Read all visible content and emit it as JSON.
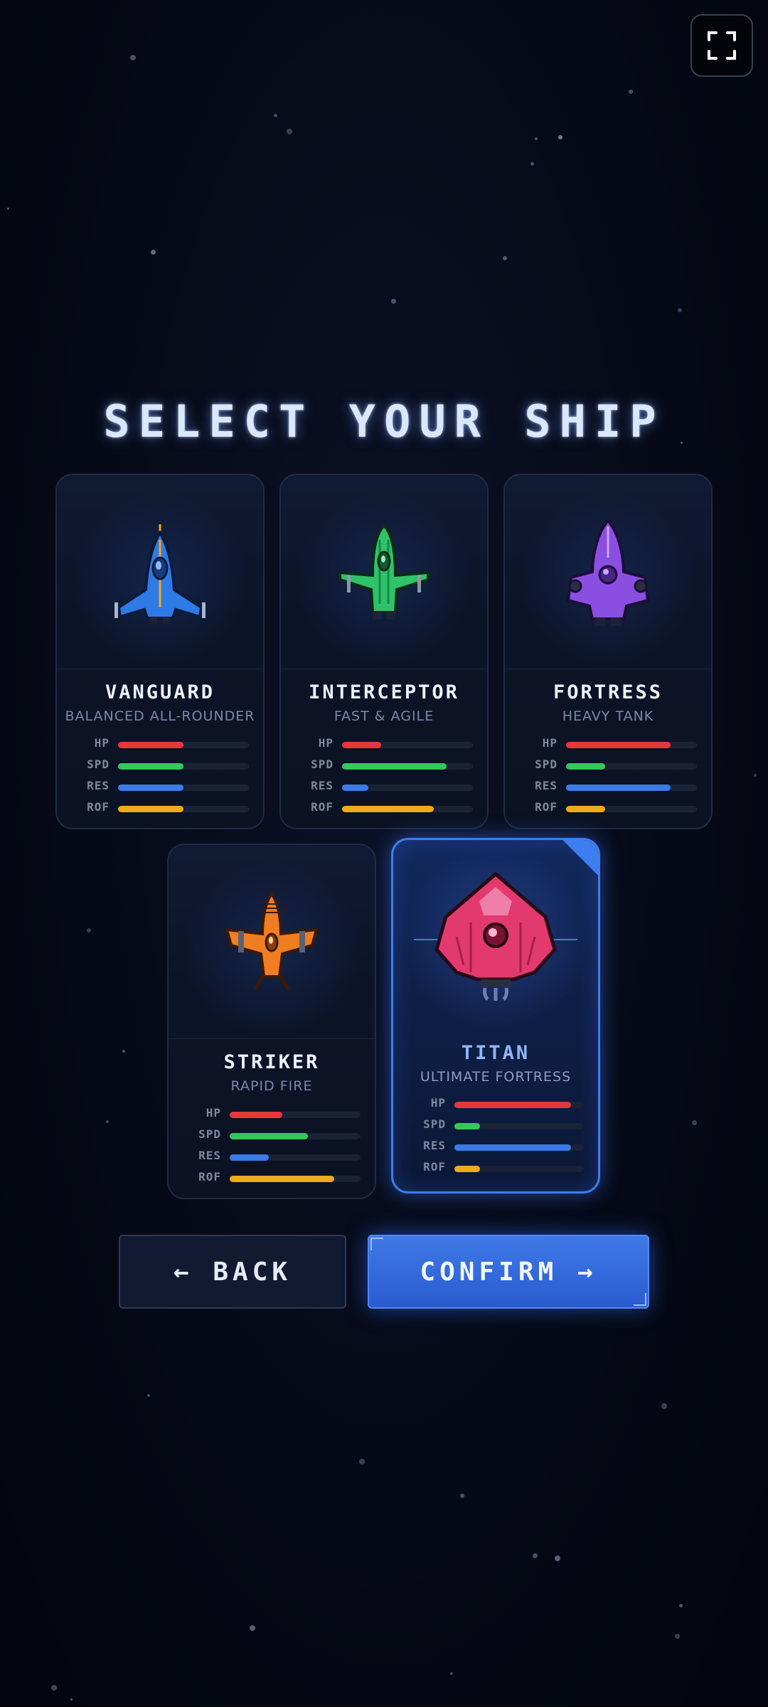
{
  "screen": {
    "title": "SELECT YOUR SHIP",
    "fullscreen_icon": "fullscreen-icon"
  },
  "ships": [
    {
      "name": "VANGUARD",
      "subtitle": "BALANCED ALL-ROUNDER",
      "color": "#2f7be6",
      "selected": false,
      "stats": [
        {
          "label": "HP",
          "value": 0.5,
          "color": "#e5383b"
        },
        {
          "label": "SPD",
          "value": 0.5,
          "color": "#35c759"
        },
        {
          "label": "RES",
          "value": 0.5,
          "color": "#3a7be8"
        },
        {
          "label": "ROF",
          "value": 0.5,
          "color": "#f0a91c"
        }
      ]
    },
    {
      "name": "INTERCEPTOR",
      "subtitle": "FAST & AGILE",
      "color": "#2ec26a",
      "selected": false,
      "stats": [
        {
          "label": "HP",
          "value": 0.3,
          "color": "#e5383b"
        },
        {
          "label": "SPD",
          "value": 0.8,
          "color": "#35c759"
        },
        {
          "label": "RES",
          "value": 0.2,
          "color": "#3a7be8"
        },
        {
          "label": "ROF",
          "value": 0.7,
          "color": "#f0a91c"
        }
      ]
    },
    {
      "name": "FORTRESS",
      "subtitle": "HEAVY TANK",
      "color": "#8a4fe0",
      "selected": false,
      "stats": [
        {
          "label": "HP",
          "value": 0.8,
          "color": "#e5383b"
        },
        {
          "label": "SPD",
          "value": 0.3,
          "color": "#35c759"
        },
        {
          "label": "RES",
          "value": 0.8,
          "color": "#3a7be8"
        },
        {
          "label": "ROF",
          "value": 0.3,
          "color": "#f0a91c"
        }
      ]
    },
    {
      "name": "STRIKER",
      "subtitle": "RAPID FIRE",
      "color": "#ef7d22",
      "selected": false,
      "stats": [
        {
          "label": "HP",
          "value": 0.4,
          "color": "#e5383b"
        },
        {
          "label": "SPD",
          "value": 0.6,
          "color": "#35c759"
        },
        {
          "label": "RES",
          "value": 0.3,
          "color": "#3a7be8"
        },
        {
          "label": "ROF",
          "value": 0.8,
          "color": "#f0a91c"
        }
      ]
    },
    {
      "name": "TITAN",
      "subtitle": "ULTIMATE FORTRESS",
      "color": "#e23a6e",
      "selected": true,
      "stats": [
        {
          "label": "HP",
          "value": 0.9,
          "color": "#e5383b"
        },
        {
          "label": "SPD",
          "value": 0.2,
          "color": "#35c759"
        },
        {
          "label": "RES",
          "value": 0.9,
          "color": "#3a7be8"
        },
        {
          "label": "ROF",
          "value": 0.2,
          "color": "#f0a91c"
        }
      ]
    }
  ],
  "buttons": {
    "back": "← BACK",
    "confirm": "CONFIRM →"
  }
}
